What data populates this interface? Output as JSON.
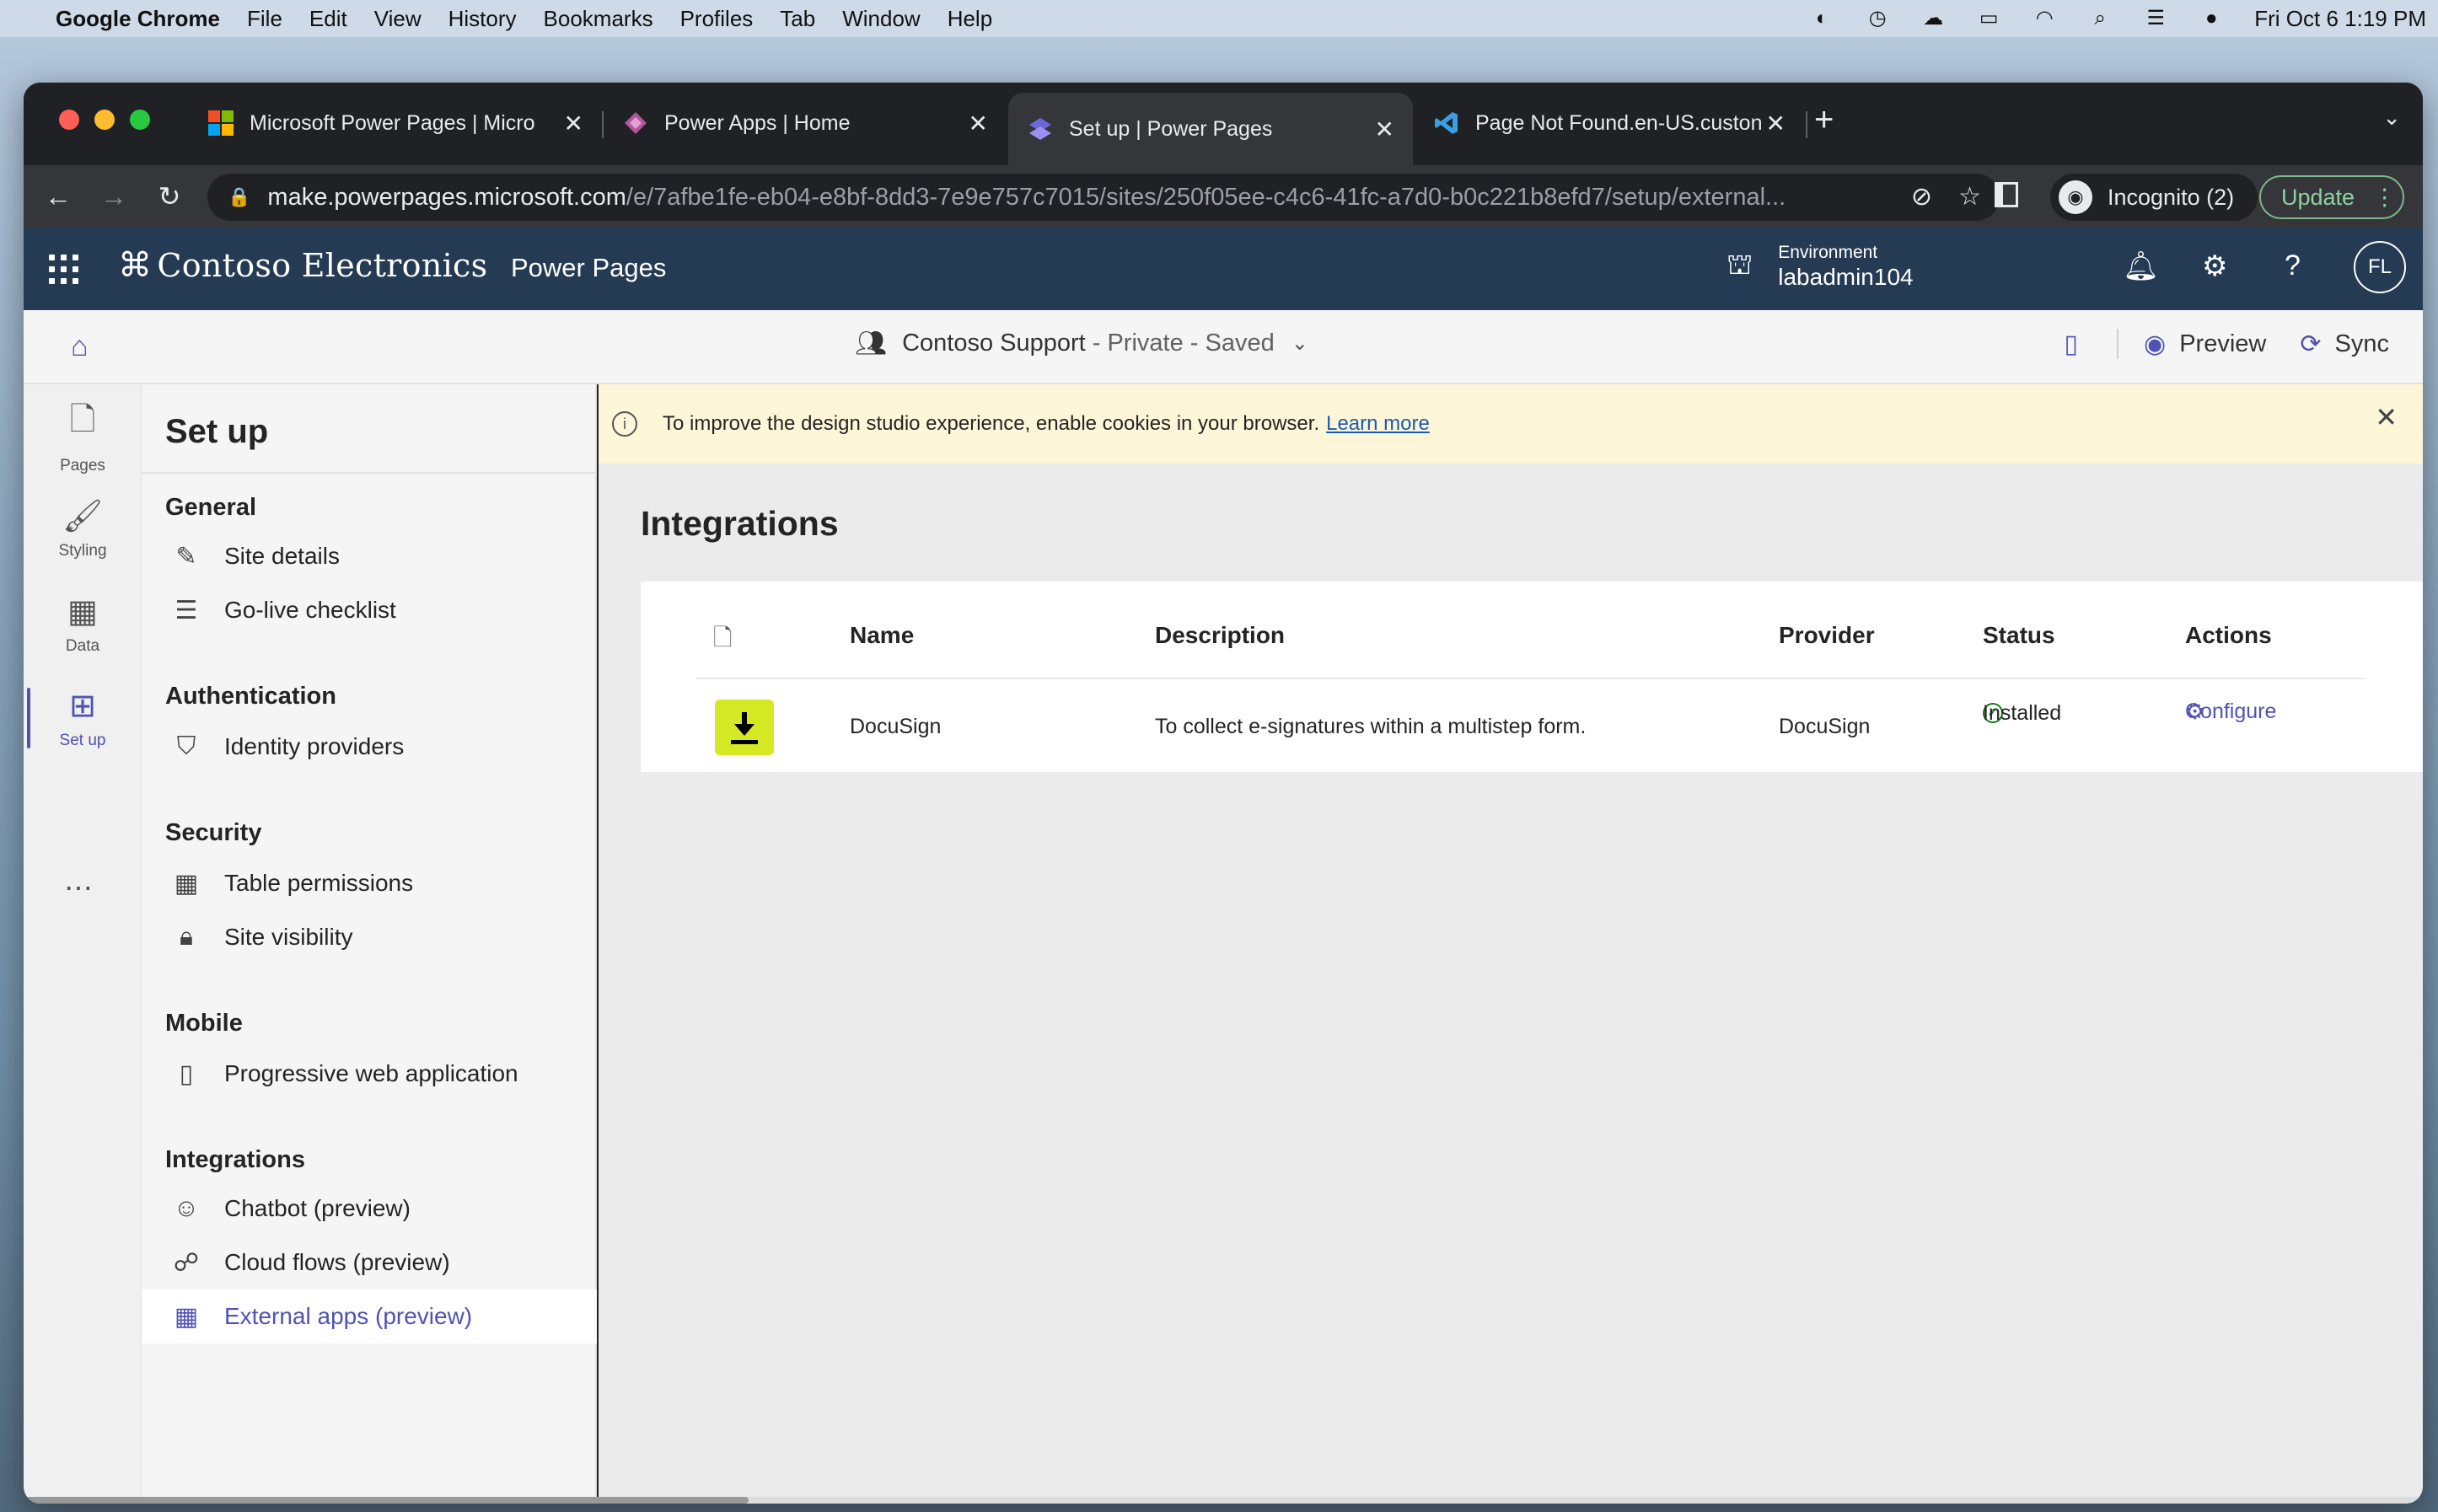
{
  "macos": {
    "app_name": "Google Chrome",
    "menus": [
      "File",
      "Edit",
      "View",
      "History",
      "Bookmarks",
      "Profiles",
      "Tab",
      "Window",
      "Help"
    ],
    "datetime": "Fri Oct 6  1:19 PM"
  },
  "browser": {
    "tabs": [
      {
        "title": "Microsoft Power Pages | Micro",
        "icon": "microsoft-logo-icon",
        "active": false
      },
      {
        "title": "Power Apps | Home",
        "icon": "power-apps-icon",
        "active": false
      },
      {
        "title": "Set up | Power Pages",
        "icon": "power-pages-icon",
        "active": true
      },
      {
        "title": "Page Not Found.en-US.custon",
        "icon": "vscode-icon",
        "active": false
      }
    ],
    "url_host": "make.powerpages.microsoft.com",
    "url_path": "/e/7afbe1fe-eb04-e8bf-8dd3-7e9e757c7015/sites/250f05ee-c4c6-41fc-a7d0-b0c221b8efd7/setup/external...",
    "incognito_label": "Incognito (2)",
    "update_label": "Update"
  },
  "header": {
    "brand": "Contoso Electronics",
    "product": "Power Pages",
    "env_label": "Environment",
    "env_value": "labadmin104",
    "avatar_initials": "FL"
  },
  "command_bar": {
    "site_name": "Contoso Support",
    "site_status": "- Private - Saved",
    "preview_label": "Preview",
    "sync_label": "Sync"
  },
  "rail": [
    {
      "label": "Pages",
      "icon": "page-icon"
    },
    {
      "label": "Styling",
      "icon": "paintbrush-icon"
    },
    {
      "label": "Data",
      "icon": "table-icon"
    },
    {
      "label": "Set up",
      "icon": "setup-icon",
      "active": true
    }
  ],
  "nav": {
    "title": "Set up",
    "sections": [
      {
        "heading": "General",
        "items": [
          {
            "label": "Site details",
            "icon": "edit-doc-icon"
          },
          {
            "label": "Go-live checklist",
            "icon": "checklist-icon"
          }
        ]
      },
      {
        "heading": "Authentication",
        "items": [
          {
            "label": "Identity providers",
            "icon": "shield-icon"
          }
        ]
      },
      {
        "heading": "Security",
        "items": [
          {
            "label": "Table permissions",
            "icon": "table-icon"
          },
          {
            "label": "Site visibility",
            "icon": "lock-icon"
          }
        ]
      },
      {
        "heading": "Mobile",
        "items": [
          {
            "label": "Progressive web application",
            "icon": "phone-icon"
          }
        ]
      },
      {
        "heading": "Integrations",
        "items": [
          {
            "label": "Chatbot (preview)",
            "icon": "bot-icon"
          },
          {
            "label": "Cloud flows (preview)",
            "icon": "flow-icon"
          },
          {
            "label": "External apps (preview)",
            "icon": "apps-grid-icon",
            "active": true
          }
        ]
      }
    ]
  },
  "banner": {
    "text": "To improve the design studio experience, enable cookies in your browser.",
    "link": "Learn more"
  },
  "main": {
    "title": "Integrations",
    "columns": [
      "Name",
      "Description",
      "Provider",
      "Status",
      "Actions"
    ],
    "rows": [
      {
        "name": "DocuSign",
        "description": "To collect e-signatures within a multistep form.",
        "provider": "DocuSign",
        "status": "Installed",
        "action": "Configure",
        "icon_color": "#d5e824"
      }
    ]
  },
  "colors": {
    "accent": "#4f52b2",
    "header_bg": "#253b54",
    "banner_bg": "#fdf6d8",
    "success": "#107c10"
  }
}
